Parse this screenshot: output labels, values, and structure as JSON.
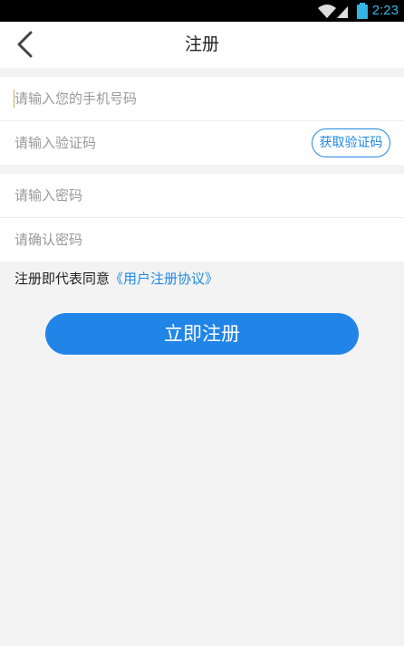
{
  "status_bar": {
    "time": "2:23",
    "icons": [
      "wifi-icon",
      "signal-icon",
      "battery-icon"
    ]
  },
  "header": {
    "title": "注册",
    "back_icon": "chevron-left-icon"
  },
  "form": {
    "phone_placeholder": "请输入您的手机号码",
    "code_placeholder": "请输入验证码",
    "get_code_label": "获取验证码",
    "password_placeholder": "请输入密码",
    "confirm_placeholder": "请确认密码"
  },
  "agreement": {
    "prefix": "注册即代表同意",
    "link": "《用户注册协议》"
  },
  "submit_label": "立即注册",
  "colors": {
    "accent": "#2185e8",
    "background": "#f3f3f3",
    "statusbar": "#000000",
    "status_accent": "#33b5e5"
  }
}
